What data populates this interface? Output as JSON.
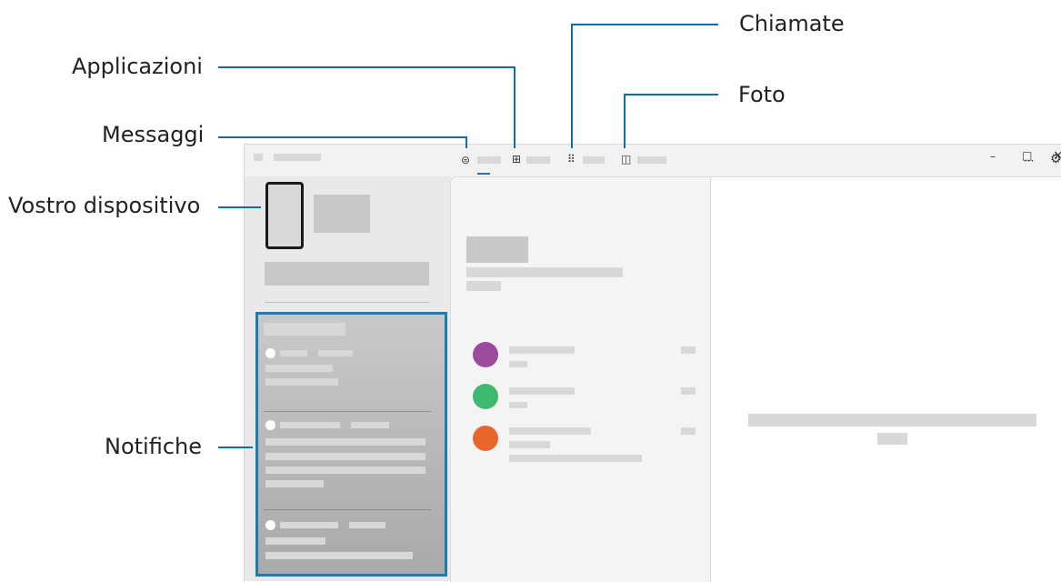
{
  "callouts": {
    "chiamate": "Chiamate",
    "applicazioni": "Applicazioni",
    "foto": "Foto",
    "messaggi": "Messaggi",
    "vostro_dispositivo": "Vostro dispositivo",
    "notifiche": "Notifiche"
  },
  "window": {
    "controls": {
      "minimize": "–",
      "maximize": "□",
      "close": "×"
    },
    "toolbar": {
      "more": "···",
      "settings": "⚙"
    },
    "tabs": [
      {
        "icon": "message-icon",
        "glyph": "⊜"
      },
      {
        "icon": "apps-icon",
        "glyph": "⊞"
      },
      {
        "icon": "calls-icon",
        "glyph": "⠿"
      },
      {
        "icon": "photos-icon",
        "glyph": "◫"
      }
    ]
  },
  "colors": {
    "callout_line": "#0e6fa8",
    "highlight_border": "#1b7bb5",
    "contact_purple": "#9b4a9e",
    "contact_green": "#3dba6f",
    "contact_orange": "#e8662c"
  }
}
